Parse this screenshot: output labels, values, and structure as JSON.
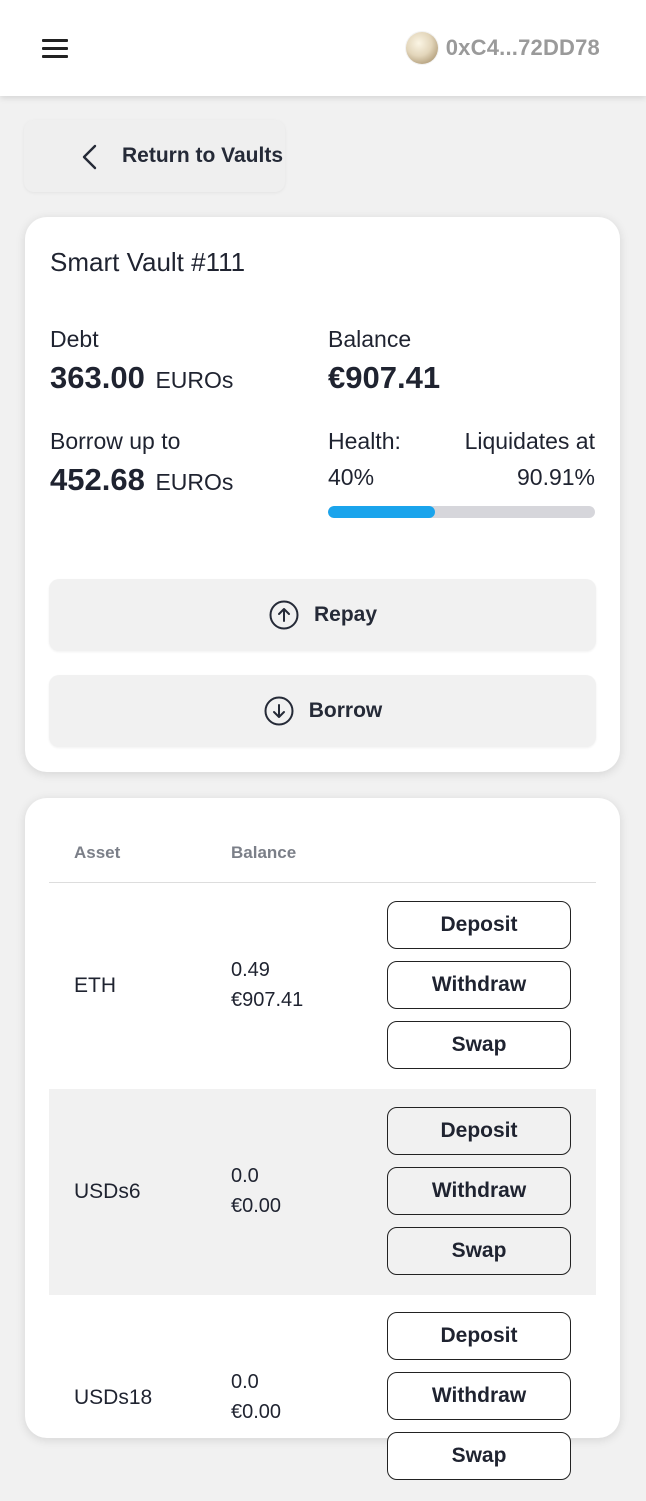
{
  "header": {
    "wallet_address": "0xC4...72DD78"
  },
  "nav": {
    "return_label": "Return to Vaults"
  },
  "vault": {
    "title": "Smart Vault #111",
    "debt_label": "Debt",
    "debt_value": "363.00",
    "debt_unit": "EUROs",
    "balance_label": "Balance",
    "balance_value": "€907.41",
    "borrow_label": "Borrow up to",
    "borrow_value": "452.68",
    "borrow_unit": "EUROs",
    "health_label": "Health:",
    "health_value": "40%",
    "health_fraction": 0.4,
    "liquidates_label": "Liquidates at",
    "liquidates_value": "90.91%",
    "repay_label": "Repay",
    "borrow_button_label": "Borrow"
  },
  "assets": {
    "headers": {
      "asset": "Asset",
      "balance": "Balance"
    },
    "rows": [
      {
        "name": "ETH",
        "amount": "0.49",
        "fiat": "€907.41",
        "deposit": "Deposit",
        "withdraw": "Withdraw",
        "swap": "Swap"
      },
      {
        "name": "USDs6",
        "amount": "0.0",
        "fiat": "€0.00",
        "deposit": "Deposit",
        "withdraw": "Withdraw",
        "swap": "Swap"
      },
      {
        "name": "USDs18",
        "amount": "0.0",
        "fiat": "€0.00",
        "deposit": "Deposit",
        "withdraw": "Withdraw",
        "swap": "Swap"
      }
    ]
  },
  "colors": {
    "health_fill": "#1aa4ec",
    "health_track": "#d6d6db",
    "page_bg": "#f1f1f1"
  }
}
